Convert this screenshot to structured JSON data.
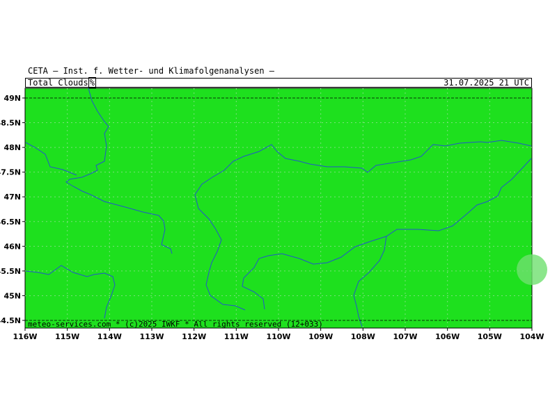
{
  "header": {
    "institute": "CETA – Inst. f. Wetter- und Klimafolgenanalysen –",
    "parameter": "Total_Clouds",
    "unit": "%",
    "datetime": "31.07.2025 21 UTC"
  },
  "map": {
    "lon_range": [
      -116,
      -104
    ],
    "lat_range": [
      44.4,
      49.2
    ],
    "fill_color": "#1ee01e",
    "grid_color": "#7be07b",
    "river_color": "#2255cc",
    "border_line_lat": 49.0,
    "x_ticks": [
      "116W",
      "115W",
      "114W",
      "113W",
      "112W",
      "111W",
      "110W",
      "109W",
      "108W",
      "107W",
      "106W",
      "105W",
      "104W"
    ],
    "y_ticks": [
      "49N",
      "48.5N",
      "48N",
      "47.5N",
      "47N",
      "46.5N",
      "46N",
      "45.5N",
      "45N",
      "44.5N"
    ]
  },
  "footer": {
    "credit": "meteo-services.com * (c)2025 IWKF * All rights reserved (12+033)"
  }
}
